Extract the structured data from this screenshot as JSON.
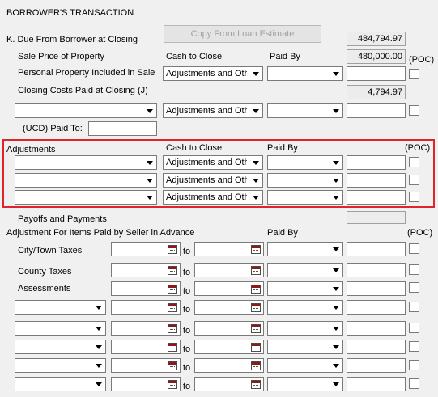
{
  "section_title": "BORROWER'S TRANSACTION",
  "k_due_label": "K. Due From Borrower at Closing",
  "copy_button": "Copy From Loan Estimate",
  "k_due_total": "484,794.97",
  "sale_price_label": "Sale Price of Property",
  "sale_price_value": "480,000.00",
  "poc_label": "(POC)",
  "cash_to_close_header": "Cash to Close",
  "paid_by_header": "Paid By",
  "personal_property_label": "Personal Property Included in Sale",
  "adj_option": "Adjustments and Other Credits",
  "closing_costs_label": "Closing Costs Paid at Closing (J)",
  "closing_costs_value": "4,794.97",
  "ucd_paid_to_label": "(UCD) Paid To:",
  "adjustments_label": "Adjustments",
  "payoffs_label": "Payoffs and Payments",
  "adj_items_label": "Adjustment For Items Paid by Seller in Advance",
  "to_label": "to",
  "city_taxes_label": "City/Town Taxes",
  "county_taxes_label": "County Taxes",
  "assessments_label": "Assessments"
}
